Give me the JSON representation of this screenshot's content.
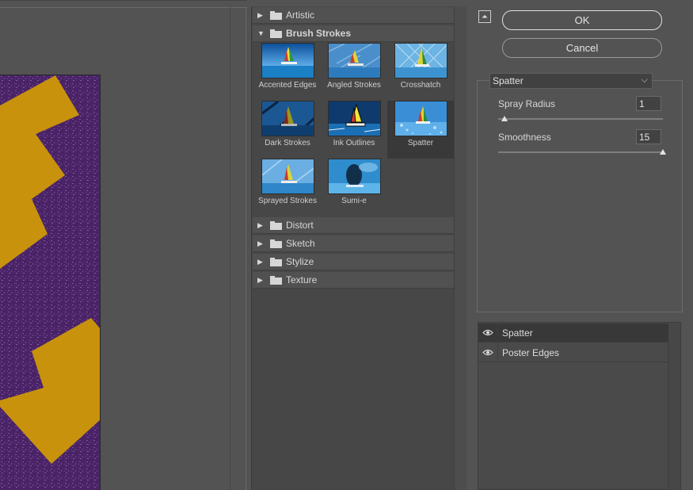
{
  "gallery": {
    "categories_top": [
      {
        "label": "Artistic",
        "open": false
      },
      {
        "label": "Brush Strokes",
        "open": true
      }
    ],
    "thumbnails": [
      {
        "label": "Accented Edges",
        "selected": false
      },
      {
        "label": "Angled Strokes",
        "selected": false
      },
      {
        "label": "Crosshatch",
        "selected": false
      },
      {
        "label": "Dark Strokes",
        "selected": false
      },
      {
        "label": "Ink Outlines",
        "selected": false
      },
      {
        "label": "Spatter",
        "selected": true
      },
      {
        "label": "Sprayed Strokes",
        "selected": false
      },
      {
        "label": "Sumi-e",
        "selected": false
      }
    ],
    "categories_bottom": [
      {
        "label": "Distort"
      },
      {
        "label": "Sketch"
      },
      {
        "label": "Stylize"
      },
      {
        "label": "Texture"
      }
    ]
  },
  "buttons": {
    "ok": "OK",
    "cancel": "Cancel"
  },
  "settings": {
    "filter": "Spatter",
    "params": [
      {
        "label": "Spray Radius",
        "value": "1",
        "min": 0,
        "max": 25,
        "level": 1
      },
      {
        "label": "Smoothness",
        "value": "15",
        "min": 1,
        "max": 15,
        "level": 15
      }
    ]
  },
  "layers": [
    {
      "name": "Spatter",
      "active": true
    },
    {
      "name": "Poster Edges",
      "active": false
    }
  ],
  "colors": {
    "background": "#535353",
    "canvas_purple": "#4a2467",
    "canvas_gold": "#c8920c"
  }
}
